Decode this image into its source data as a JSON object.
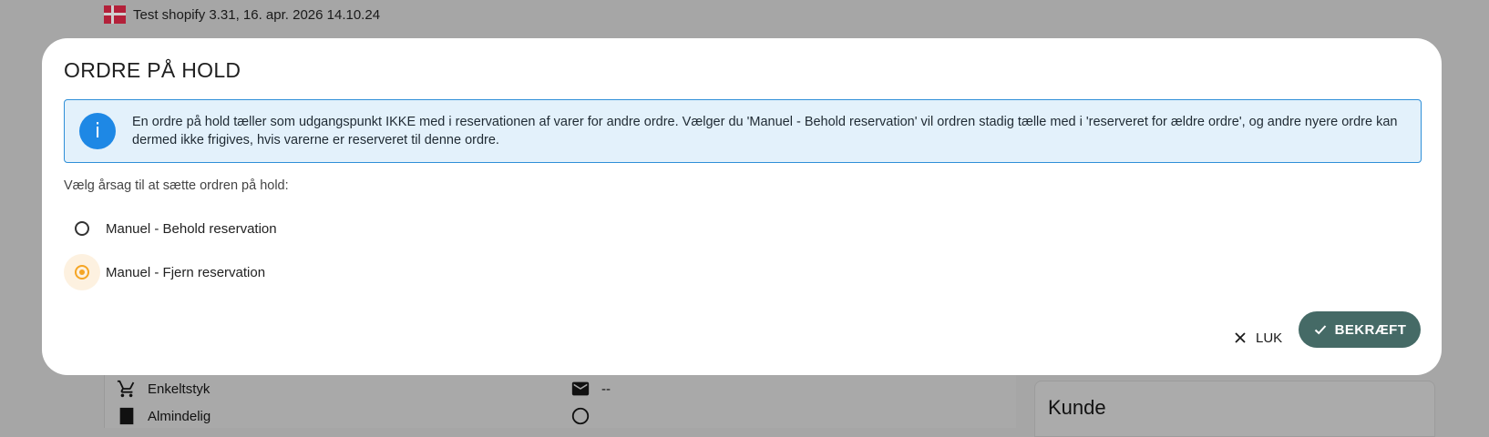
{
  "background": {
    "header_text": "Test shopify 3.31, 16. apr. 2026 14.10.24",
    "rows": [
      {
        "icon": "shopping-cart-icon",
        "label": "Enkeltstyk"
      },
      {
        "icon": "mail-icon",
        "label": "--"
      },
      {
        "icon": "document-icon",
        "label": "Almindelig"
      }
    ],
    "side_card_title": "Kunde"
  },
  "dialog": {
    "title": "ORDRE PÅ HOLD",
    "alert_text": "En ordre på hold tæller som udgangspunkt IKKE med i reservationen af varer for andre ordre. Vælger du 'Manuel - Behold reservation' vil ordren stadig tælle med i 'reserveret for ældre ordre', og andre nyere ordre kan dermed ikke frigives, hvis varerne er reserveret til denne ordre.",
    "prompt": "Vælg årsag til at sætte ordren på hold:",
    "options": [
      {
        "label": "Manuel - Behold reservation",
        "selected": false
      },
      {
        "label": "Manuel - Fjern reservation",
        "selected": true
      }
    ],
    "close_label": "LUK",
    "confirm_label": "BEKRÆFT"
  },
  "colors": {
    "overlay": "#a6a6a6",
    "info": "#1e88e5",
    "info_bg": "#e3f1fb",
    "radio_selected": "#f5a524",
    "confirm_button": "#456a66"
  }
}
